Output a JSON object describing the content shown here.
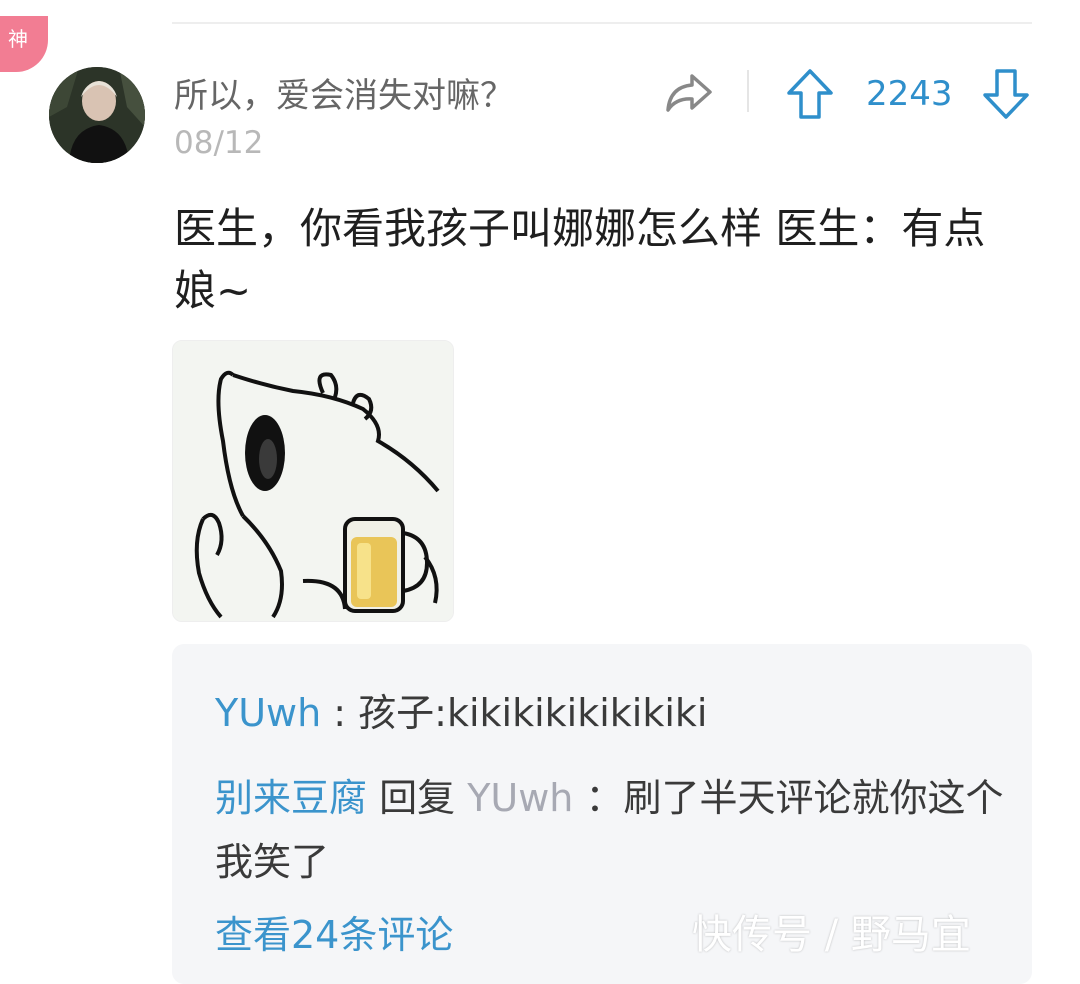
{
  "badge": {
    "label": "神",
    "color": "#f27d93"
  },
  "post": {
    "username": "所以，爱会消失对嘛？",
    "date": "08/12",
    "vote_count": "2243",
    "text": "医生，你看我孩子叫娜娜怎么样 医生：有点娘~",
    "accent_color": "#2f8fcb"
  },
  "icons": {
    "share": "share-arrow-icon",
    "upvote": "arrow-up-icon",
    "downvote": "arrow-down-icon"
  },
  "comments": [
    {
      "author": "YUwh",
      "separator": " : ",
      "text": "孩子:kikikikikikikiki"
    },
    {
      "author": "别来豆腐",
      "reply_word": " 回复 ",
      "reply_to": "YUwh",
      "separator": " ：",
      "text": "刷了半天评论就你这个我笑了"
    }
  ],
  "view_more": "查看24条评论",
  "watermark": "快传号 / 野马宜"
}
